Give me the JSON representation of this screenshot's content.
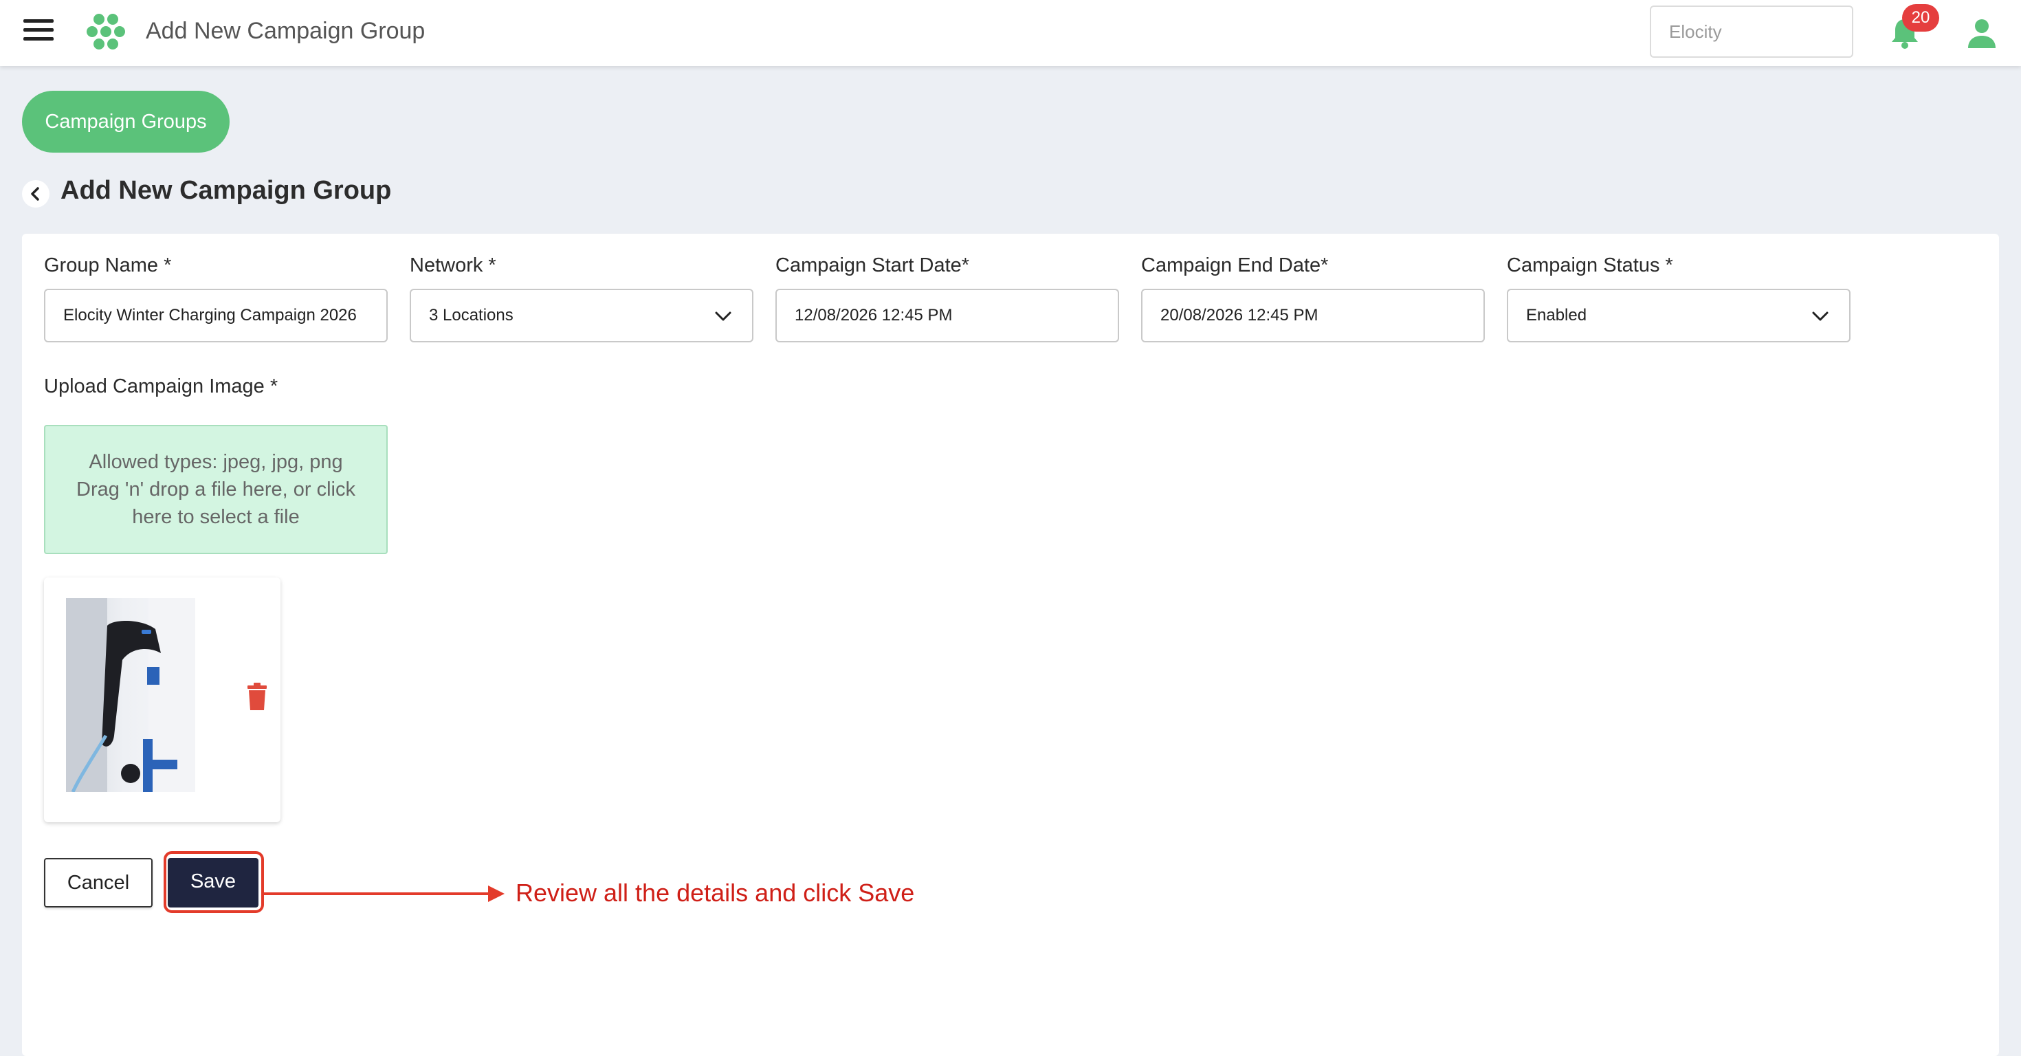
{
  "header": {
    "title": "Add New Campaign Group",
    "tenant_value": "Elocity",
    "notifications_count": "20"
  },
  "breadcrumb": {
    "pill_label": "Campaign Groups"
  },
  "page": {
    "title": "Add New Campaign Group"
  },
  "form": {
    "group_name": {
      "label": "Group Name *",
      "value": "Elocity Winter Charging Campaign 2026"
    },
    "network": {
      "label": "Network *",
      "value": "3 Locations"
    },
    "start_date": {
      "label": "Campaign Start Date*",
      "value": "12/08/2026 12:45 PM"
    },
    "end_date": {
      "label": "Campaign End Date*",
      "value": "20/08/2026 12:45 PM"
    },
    "status": {
      "label": "Campaign Status *",
      "value": "Enabled"
    },
    "upload": {
      "label": "Upload Campaign Image *",
      "line1": "Allowed types: jpeg, jpg, png",
      "line2": "Drag 'n' drop a file here, or click here to select a file"
    }
  },
  "actions": {
    "cancel_label": "Cancel",
    "save_label": "Save"
  },
  "annotation": {
    "text": "Review all the details and click Save"
  },
  "colors": {
    "brand_green": "#5bc27a",
    "save_button": "#1f2540",
    "annotation_red": "#e33b2a",
    "dropzone_bg": "#d3f5e1",
    "trash_red": "#e04b3c"
  },
  "icons": [
    "menu-icon",
    "logo-icon",
    "bell-icon",
    "user-icon",
    "back-arrow-icon",
    "chevron-down-icon",
    "trash-icon"
  ]
}
